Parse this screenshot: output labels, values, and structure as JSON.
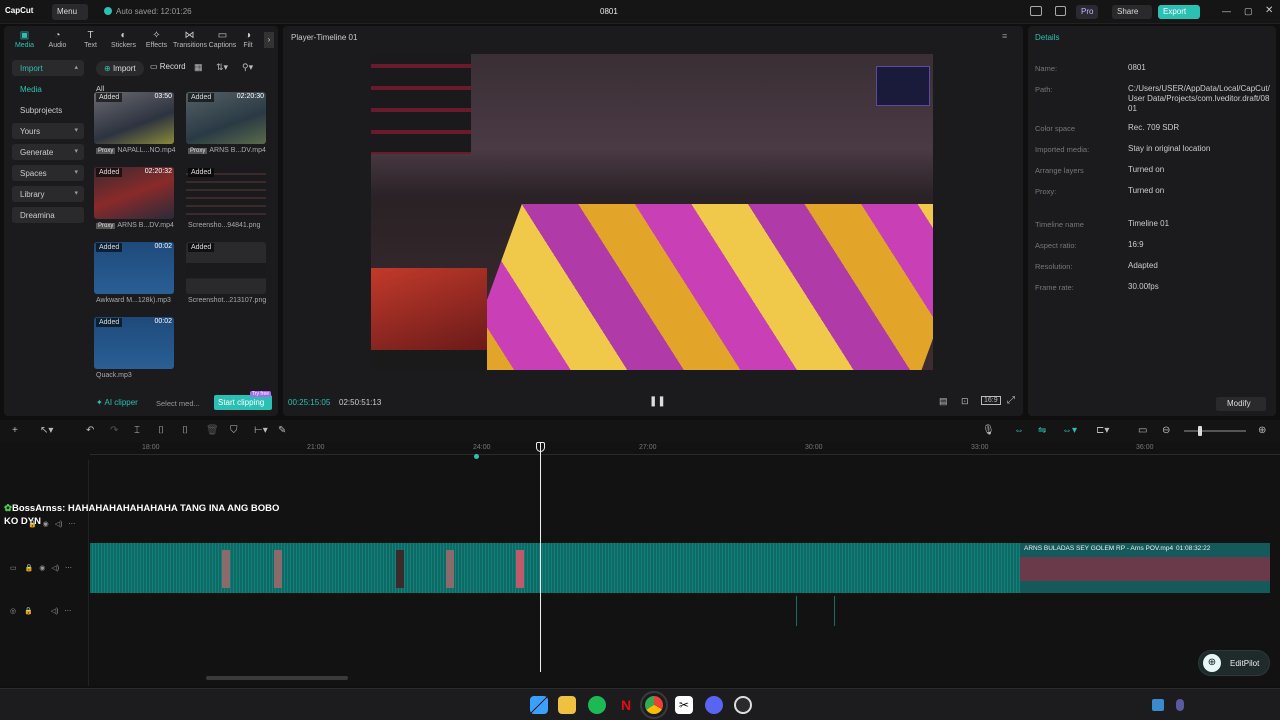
{
  "titlebar": {
    "logo": "CapCut",
    "menu": "Menu",
    "autosave": "Auto saved: 12:01:26",
    "project_title": "0801",
    "pro": "Pro",
    "share": "Share",
    "export": "Export"
  },
  "left_tabs": [
    "Media",
    "Audio",
    "Text",
    "Stickers",
    "Effects",
    "Transitions",
    "Captions",
    "Filt"
  ],
  "sidebar": {
    "items": [
      {
        "label": "Import"
      },
      {
        "label": "Media"
      },
      {
        "label": "Subprojects"
      },
      {
        "label": "Yours"
      },
      {
        "label": "Generate"
      },
      {
        "label": "Spaces"
      },
      {
        "label": "Library"
      },
      {
        "label": "Dreamina"
      }
    ]
  },
  "media_toolbar": {
    "import": "Import",
    "record": "Record",
    "filter_all": "All"
  },
  "media_items": [
    {
      "badge": "Added",
      "duration": "03:50",
      "name": "NAPALL...NO.mp4",
      "proxy": "Proxy"
    },
    {
      "badge": "Added",
      "duration": "02:20:30",
      "name": "ARNS B...DV.mp4",
      "proxy": "Proxy"
    },
    {
      "badge": "Added",
      "duration": "02:20:32",
      "name": "ARNS B...DV.mp4",
      "proxy": "Proxy"
    },
    {
      "badge": "Added",
      "duration": "",
      "name": "Screensho...94841.png",
      "proxy": ""
    },
    {
      "badge": "Added",
      "duration": "00:02",
      "name": "Awkward M...128k).mp3",
      "proxy": ""
    },
    {
      "badge": "Added",
      "duration": "",
      "name": "Screenshot...213107.png",
      "proxy": ""
    },
    {
      "badge": "Added",
      "duration": "00:02",
      "name": "Quack.mp3",
      "proxy": ""
    }
  ],
  "clipper": {
    "ai": "AI clipper",
    "select": "Select med...",
    "start": "Start clipping",
    "try": "Try free"
  },
  "player": {
    "title": "Player-Timeline 01",
    "current_time": "00:25:15:05",
    "total_time": "02:50:51:13"
  },
  "details": {
    "heading": "Details",
    "rows": [
      {
        "label": "Name:",
        "value": "0801"
      },
      {
        "label": "Path:",
        "value": "C:/Users/USER/AppData/Local/CapCut/User Data/Projects/com.lveditor.draft/0801"
      },
      {
        "label": "Color space",
        "value": "Rec. 709 SDR"
      },
      {
        "label": "Imported media:",
        "value": "Stay in original location"
      },
      {
        "label": "Arrange layers",
        "value": "Turned on"
      },
      {
        "label": "Proxy:",
        "value": "Turned on"
      },
      {
        "label": "Timeline name",
        "value": "Timeline 01"
      },
      {
        "label": "Aspect ratio:",
        "value": "16:9"
      },
      {
        "label": "Resolution:",
        "value": "Adapted"
      },
      {
        "label": "Frame rate:",
        "value": "30.00fps"
      }
    ],
    "modify": "Modify"
  },
  "ruler_labels": [
    "18:00",
    "21:00",
    "24:00",
    "27:00",
    "30:00",
    "33:00",
    "36:00"
  ],
  "caption_text": "BossArnss: HAHAHAHAHAHAHAHA TANG INA ANG BOBO KO DYN",
  "clip_label": "ARNS BULADAS SEY GOLEM RP - Arns POV.mp4",
  "clip_duration": "01:08:32:22",
  "editpilot": "EditPilot",
  "colors": {
    "accent": "#2bc0b4",
    "track": "#0f6a66"
  }
}
